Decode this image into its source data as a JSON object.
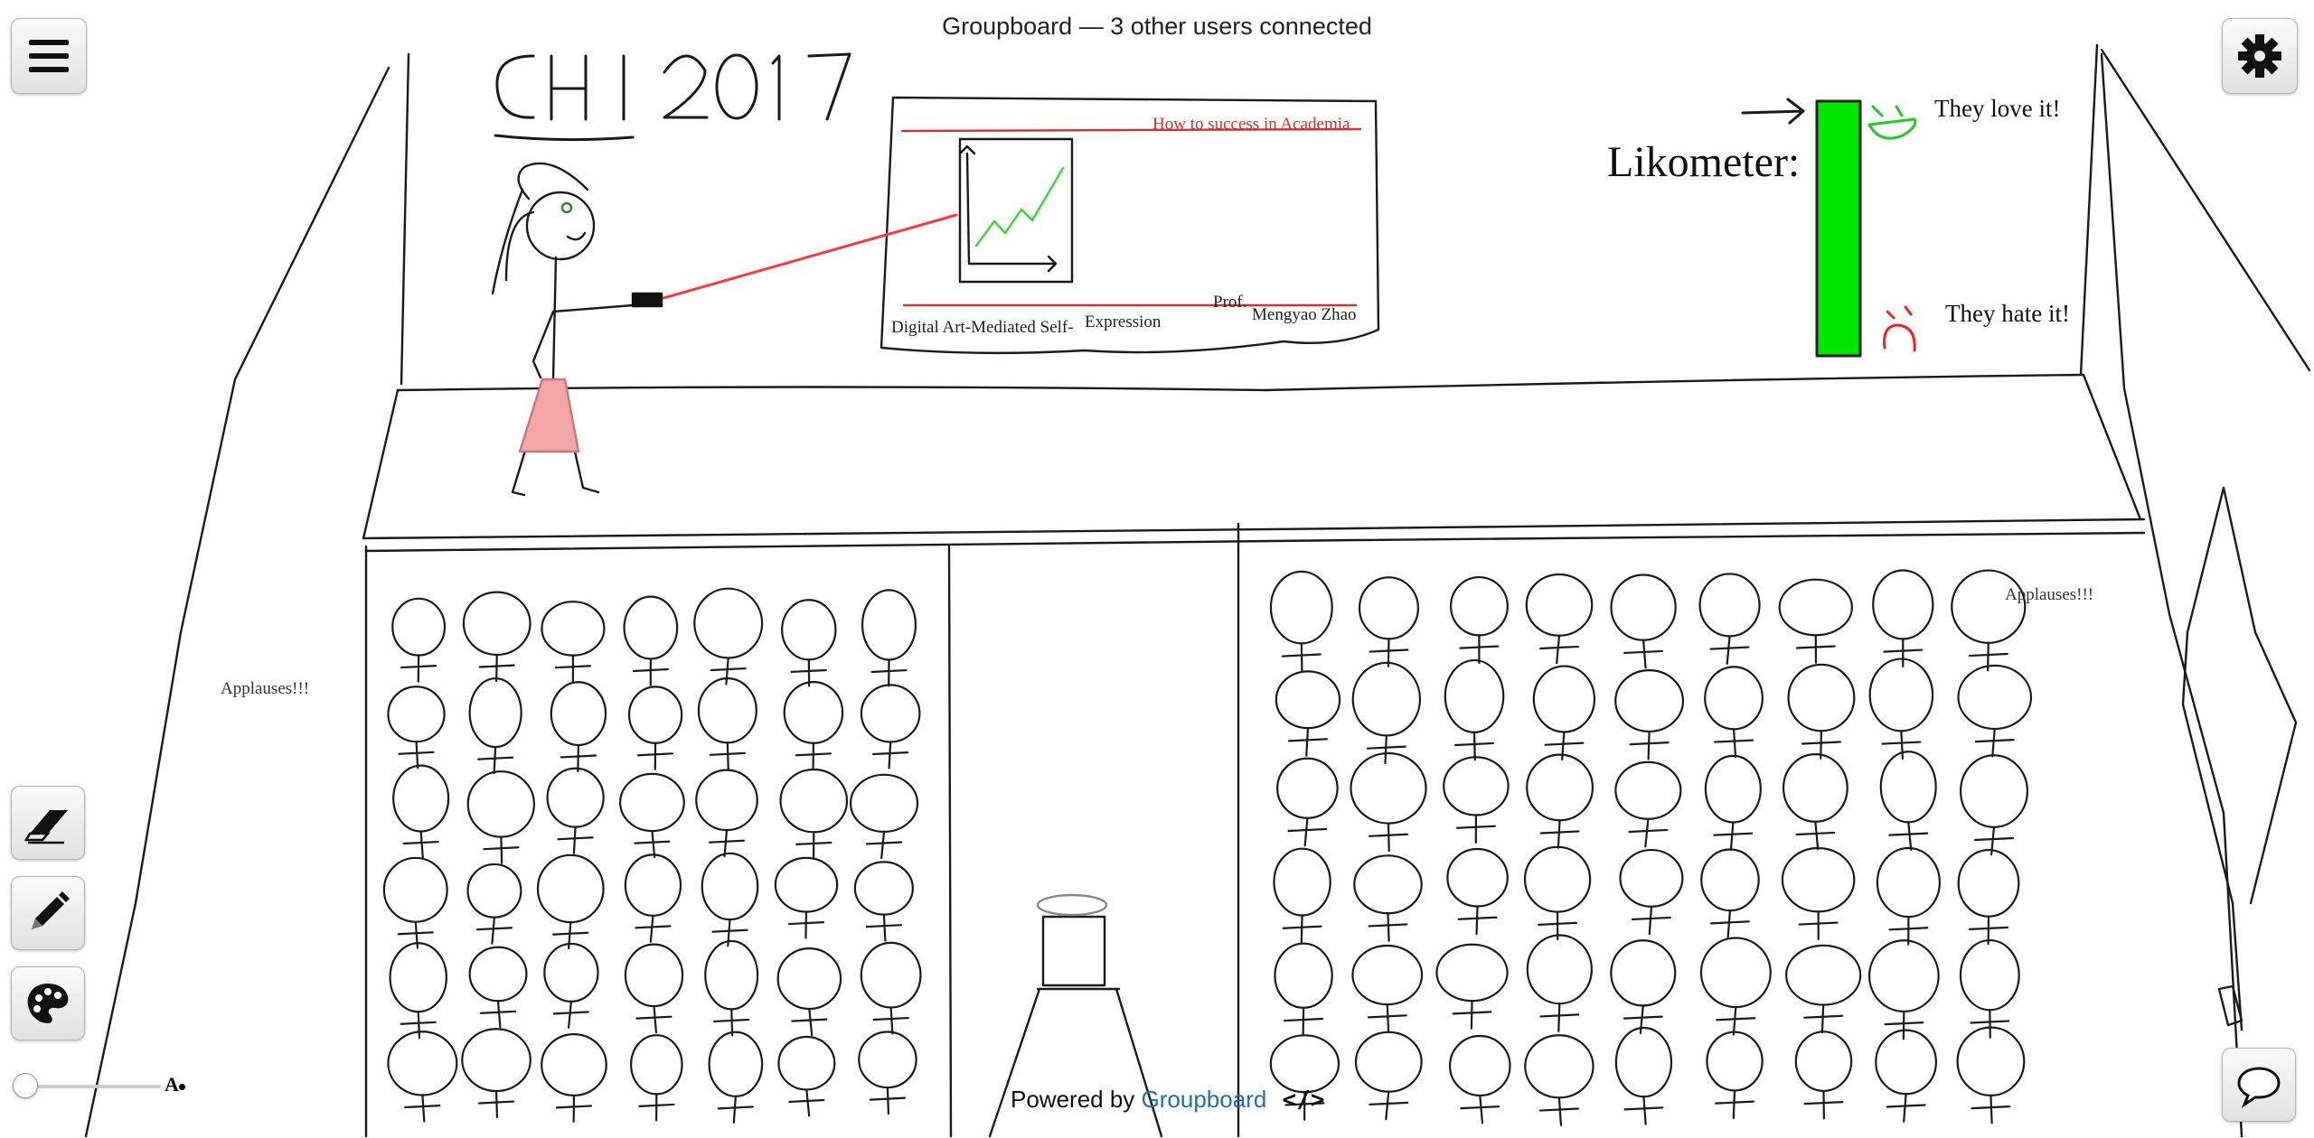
{
  "status": {
    "text": "Groupboard — 3 other users connected"
  },
  "footer": {
    "powered_label": "Powered by",
    "brand": "Groupboard",
    "code_glyph": "</>"
  },
  "toolbar": {
    "menu_icon": "hamburger-menu-icon",
    "settings_icon": "gear-icon",
    "eraser_icon": "eraser-icon",
    "pencil_icon": "pencil-icon",
    "palette_icon": "palette-icon",
    "chat_icon": "chat-bubble-icon",
    "size_label": "A"
  },
  "drawing": {
    "heading": "CHI 2017",
    "slide_title": "How to success in Academia",
    "slide_footer_left": "Digital Art-Mediated Self-",
    "slide_footer_mid": "Expression",
    "slide_footer_prof": "Prof.",
    "slide_footer_name": "Mengyao Zhao",
    "likometer_label": "Likometer:",
    "love_text": "They love it!",
    "hate_text": "They hate it!",
    "applause_left": "Applauses!!!",
    "applause_right": "Applauses!!!"
  },
  "colors": {
    "meter_green": "#00e600",
    "laser_red": "#ff3b3b",
    "link_blue": "#1f6fb2",
    "skirt_pink": "#f4a6a6",
    "love_green": "#22cc22",
    "hate_red": "#ee2222"
  }
}
